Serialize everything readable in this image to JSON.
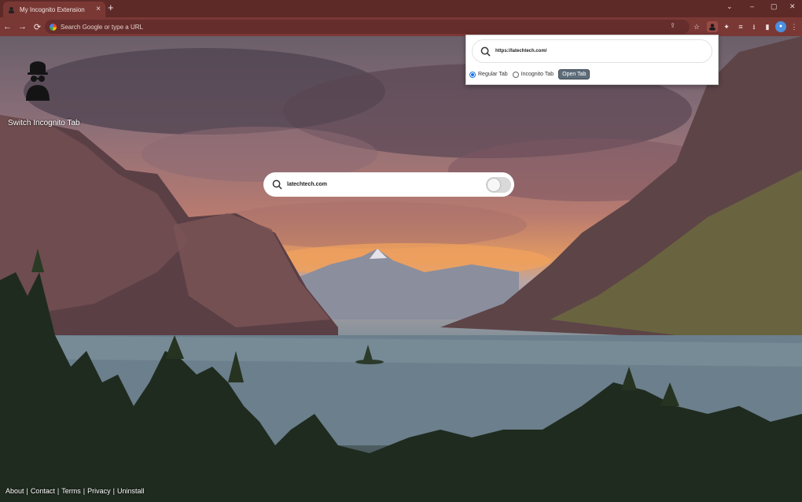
{
  "browser": {
    "tab_title": "My Incognito Extension",
    "tab_close": "×",
    "new_tab": "+",
    "window_controls": [
      "⌄",
      "–",
      "▢",
      "✕"
    ],
    "omnibox_placeholder": "Search Google or type a URL",
    "nav": {
      "back": "←",
      "forward": "→",
      "reload": "⟳"
    },
    "toolbar_icons": [
      "share-icon",
      "star-icon",
      "incognito-extension-icon",
      "puzzle-icon",
      "media-icon",
      "download-icon",
      "sidepanel-icon",
      "avatar-icon",
      "menu-icon"
    ]
  },
  "panel": {
    "label": "Switch Incognito Tab"
  },
  "search": {
    "value": "latechtech.com",
    "toggle_state": "off"
  },
  "popup": {
    "url_value": "https://latechtech.com/",
    "option_regular": "Regular Tab",
    "option_incognito": "Incognito Tab",
    "selected": "Regular Tab",
    "open_button": "Open Tab"
  },
  "footer": {
    "links": [
      "About",
      "Contact",
      "Terms",
      "Privacy",
      "Uninstall"
    ],
    "separator": "|"
  },
  "colors": {
    "tabbar": "#5e2a28",
    "toolbar": "#7a3835",
    "accent": "#1a73e8"
  }
}
